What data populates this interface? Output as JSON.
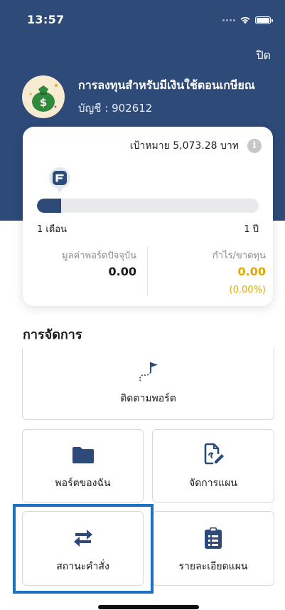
{
  "status_bar": {
    "time": "13:57"
  },
  "header": {
    "close_label": "ปิด",
    "plan_name": "การลงทุนสำหรับมีเงินใช้ตอนเกษียณ",
    "account": "บัญชี : 902612"
  },
  "summary": {
    "target": "เป้าหมาย 5,073.28 บาท",
    "progress_fraction": 0.11,
    "progress_start": "1 เดือน",
    "progress_end": "1 ปี",
    "current_value_label": "มูลค่าพอร์ตปัจจุบัน",
    "current_value": "0.00",
    "profit_label": "กำไร/ขาดทุน",
    "profit_value": "0.00",
    "profit_percent": "(0.00%)"
  },
  "manage": {
    "title": "การจัดการ",
    "items": [
      {
        "label": "ติดตามพอร์ต",
        "icon": "goal-path-icon"
      },
      {
        "label": "พอร์ตของฉัน",
        "icon": "folder-icon"
      },
      {
        "label": "จัดการแผน",
        "icon": "edit-document-icon"
      },
      {
        "label": "สถานะคำสั่ง",
        "icon": "swap-arrows-icon"
      },
      {
        "label": "รายละเอียดแผน",
        "icon": "clipboard-list-icon"
      }
    ]
  },
  "colors": {
    "brand": "#2d4a78",
    "profit": "#e0a800",
    "highlight": "#1b72c4"
  }
}
